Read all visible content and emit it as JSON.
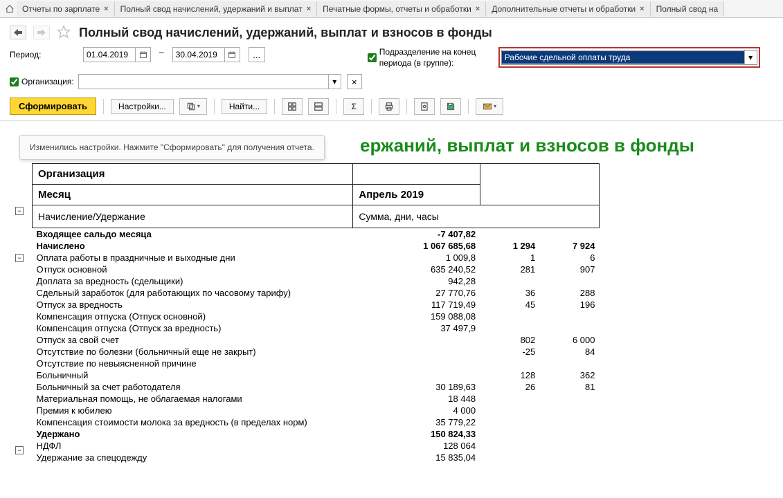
{
  "tabs": [
    "Отчеты по зарплате",
    "Полный свод начислений, удержаний и выплат",
    "Печатные формы, отчеты и обработки",
    "Дополнительные отчеты и обработки",
    "Полный свод на"
  ],
  "page_title": "Полный свод начислений, удержаний, выплат и взносов в фонды",
  "filters": {
    "period_label": "Период:",
    "date_from": "01.04.2019",
    "date_to": "30.04.2019",
    "ellipsis": "...",
    "dept_check_label": "Подразделение на конец периода (в группе):",
    "dept_value": "Рабочие сдельной оплаты труда",
    "org_check_label": "Организация:",
    "org_value": ""
  },
  "toolbar": {
    "generate": "Сформировать",
    "settings": "Настройки...",
    "find": "Найти..."
  },
  "hint": "Изменились настройки. Нажмите \"Сформировать\" для получения отчета.",
  "report": {
    "title_partial": "ержаний, выплат и взносов в фонды",
    "header": {
      "org_label": "Организация",
      "month_label": "Месяц",
      "month_value": "Апрель 2019"
    },
    "col_headers": {
      "c1": "Начисление/Удержание",
      "c2": "Сумма, дни, часы"
    },
    "rows": [
      {
        "label": "Входящее сальдо месяца",
        "sum": "-7 407,82",
        "d": "",
        "h": "",
        "bold": true
      },
      {
        "label": "Начислено",
        "sum": "1 067 685,68",
        "d": "1 294",
        "h": "7 924",
        "bold": true
      },
      {
        "label": "Оплата работы в праздничные и выходные дни",
        "sum": "1 009,8",
        "d": "1",
        "h": "6"
      },
      {
        "label": "Отпуск основной",
        "sum": "635 240,52",
        "d": "281",
        "h": "907"
      },
      {
        "label": "Доплата за вредность (сдельщики)",
        "sum": "942,28",
        "d": "",
        "h": ""
      },
      {
        "label": "Сдельный заработок (для работающих по часовому тарифу)",
        "sum": "27 770,76",
        "d": "36",
        "h": "288"
      },
      {
        "label": "Отпуск за вредность",
        "sum": "117 719,49",
        "d": "45",
        "h": "196"
      },
      {
        "label": "Компенсация отпуска (Отпуск основной)",
        "sum": "159 088,08",
        "d": "",
        "h": ""
      },
      {
        "label": "Компенсация отпуска (Отпуск за вредность)",
        "sum": "37 497,9",
        "d": "",
        "h": ""
      },
      {
        "label": "Отпуск за свой счет",
        "sum": "",
        "d": "802",
        "h": "6 000"
      },
      {
        "label": "Отсутствие по болезни (больничный еще не закрыт)",
        "sum": "",
        "d": "-25",
        "h": "84"
      },
      {
        "label": "Отсутствие по невыясненной причине",
        "sum": "",
        "d": "",
        "h": ""
      },
      {
        "label": "Больничный",
        "sum": "",
        "d": "128",
        "h": "362"
      },
      {
        "label": "Больничный за счет работодателя",
        "sum": "30 189,63",
        "d": "26",
        "h": "81"
      },
      {
        "label": "Материальная помощь, не облагаемая налогами",
        "sum": "18 448",
        "d": "",
        "h": ""
      },
      {
        "label": "Премия к юбилею",
        "sum": "4 000",
        "d": "",
        "h": ""
      },
      {
        "label": "Компенсация стоимости молока за вредность (в пределах норм)",
        "sum": "35 779,22",
        "d": "",
        "h": ""
      },
      {
        "label": "Удержано",
        "sum": "150 824,33",
        "d": "",
        "h": "",
        "bold": true
      },
      {
        "label": "НДФЛ",
        "sum": "128 064",
        "d": "",
        "h": ""
      },
      {
        "label": "Удержание за спецодежду",
        "sum": "15 835,04",
        "d": "",
        "h": ""
      }
    ]
  }
}
